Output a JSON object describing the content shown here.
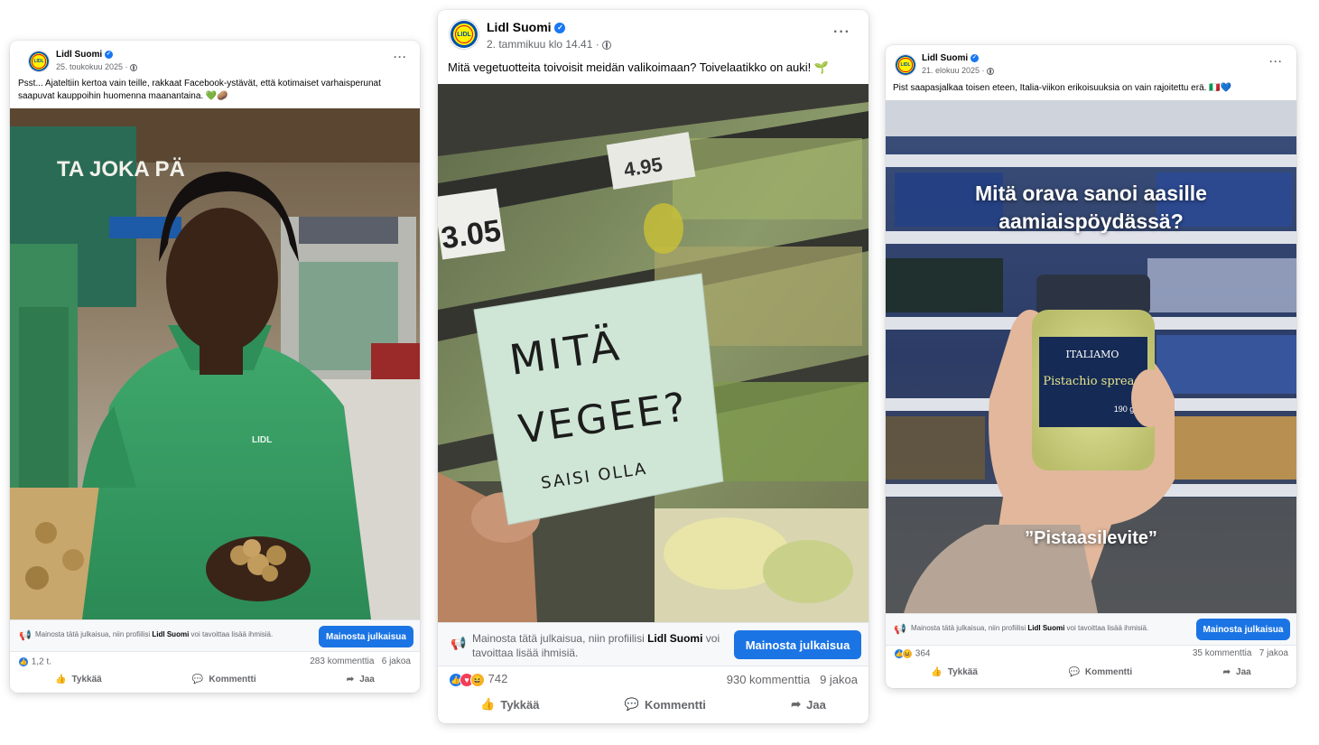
{
  "colors": {
    "facebook_blue": "#1b74e4",
    "lidl_blue": "#0050aa",
    "lidl_yellow": "#fff200",
    "lidl_red": "#e60a14",
    "muted_text": "#65676b"
  },
  "logo": {
    "text": "LIDL"
  },
  "posts": [
    {
      "page_name": "Lidl Suomi",
      "date": "25. toukokuu 2025 ·",
      "caption": "Psst... Ajateltiin kertoa vain teille, rakkaat Facebook-ystävät, että kotimaiset varhaisperunat saapuvat kauppoihin huomenna maanantaina. 💚🥔",
      "photo": {
        "store_sign": "TA JOKA PÄ",
        "shirt_logo": "LIDL"
      },
      "promo": {
        "text_before": "Mainosta tätä julkaisua, niin profiilisi ",
        "text_page": "Lidl Suomi",
        "text_after": " voi tavoittaa lisää ihmisiä.",
        "button": "Mainosta julkaisua"
      },
      "reactions": "1,2 t.",
      "comments": "283 kommenttia",
      "shares": "6 jakoa",
      "actions": {
        "like": "Tykkää",
        "comment": "Kommentti",
        "share": "Jaa"
      }
    },
    {
      "page_name": "Lidl Suomi",
      "date": "2. tammikuu klo 14.41 ·",
      "caption": "Mitä vegetuotteita toivoisit meidän valikoimaan? Toivelaatikko on auki! 🌱",
      "photo": {
        "note_line1": "MITÄ",
        "note_line2": "VEGEE?",
        "note_line3": "SAISI OLLA",
        "price_tag": "3.05",
        "price_tag2": "4.95"
      },
      "promo": {
        "text_before": "Mainosta tätä julkaisua, niin profiilisi ",
        "text_page": "Lidl Suomi",
        "text_after": " voi tavoittaa lisää ihmisiä.",
        "button": "Mainosta julkaisua"
      },
      "reactions": "742",
      "comments": "930 kommenttia",
      "shares": "9 jakoa",
      "actions": {
        "like": "Tykkää",
        "comment": "Kommentti",
        "share": "Jaa"
      }
    },
    {
      "page_name": "Lidl Suomi",
      "date": "21. elokuu 2025 ·",
      "caption": "Pist saapasjalkaa toisen eteen, Italia-viikon erikoisuuksia on vain rajoitettu erä. 🇮🇹💙",
      "photo": {
        "headline": "Mitä orava sanoi aasille aamiaispöydässä?",
        "answer": "”Pistaasilevite”",
        "jar_brand": "ITALIAMO",
        "jar_product": "Pistachio spread",
        "jar_weight": "190 g"
      },
      "promo": {
        "text_before": "Mainosta tätä julkaisua, niin profiilisi ",
        "text_page": "Lidl Suomi",
        "text_after": " voi tavoittaa lisää ihmisiä.",
        "button": "Mainosta julkaisua"
      },
      "reactions": "364",
      "comments": "35 kommenttia",
      "shares": "7 jakoa",
      "actions": {
        "like": "Tykkää",
        "comment": "Kommentti",
        "share": "Jaa"
      }
    }
  ]
}
